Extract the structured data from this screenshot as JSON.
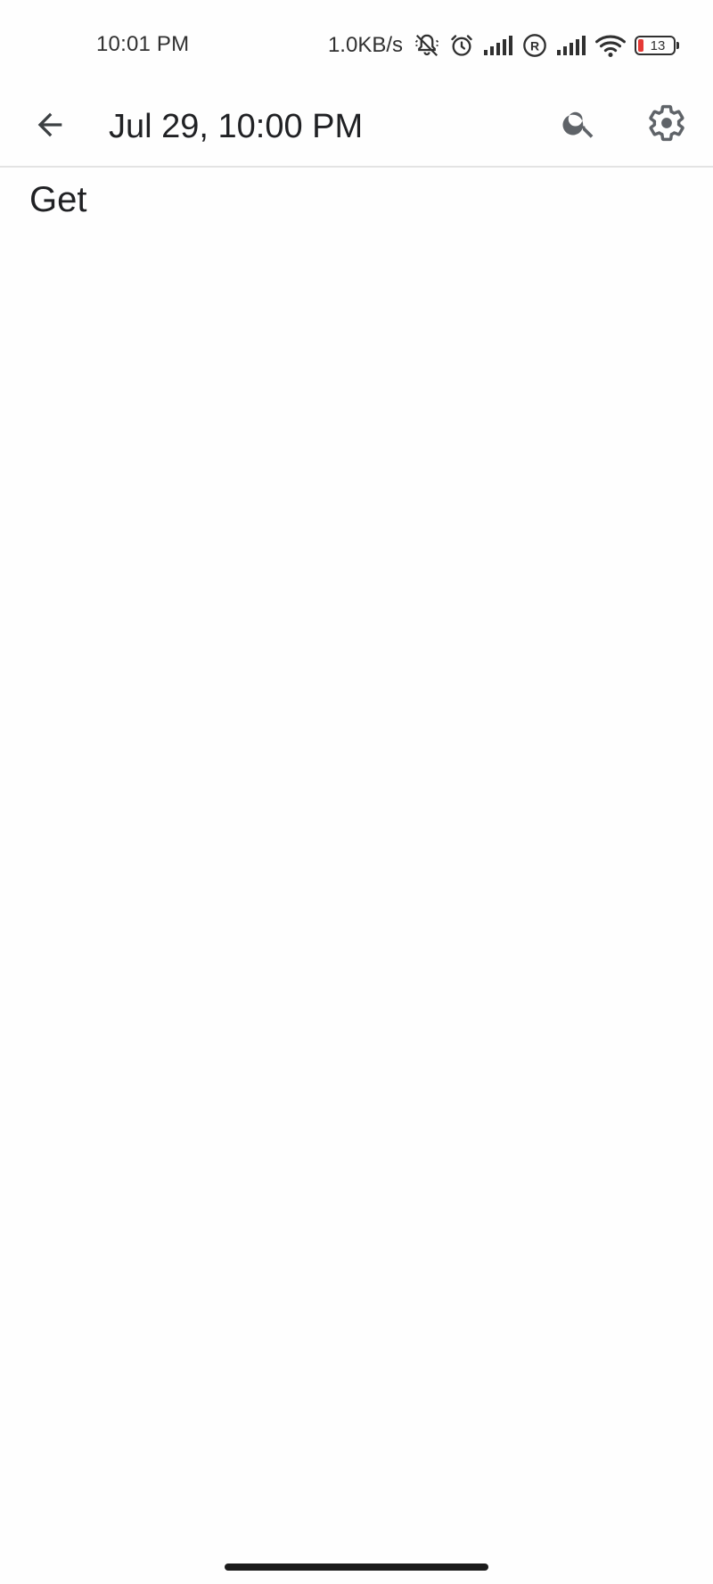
{
  "status_bar": {
    "time": "10:01 PM",
    "network_speed": "1.0KB/s",
    "battery_level": "13",
    "icons": [
      "muted-bell-icon",
      "alarm-icon",
      "signal-icon",
      "registered-icon",
      "signal-icon",
      "wifi-icon",
      "battery-icon"
    ],
    "battery_color": "#e53935"
  },
  "app_bar": {
    "title": "Jul 29, 10:00 PM",
    "icons": [
      "back-arrow-icon",
      "search-icon",
      "settings-gear-icon"
    ]
  },
  "note": {
    "body": "Get"
  }
}
